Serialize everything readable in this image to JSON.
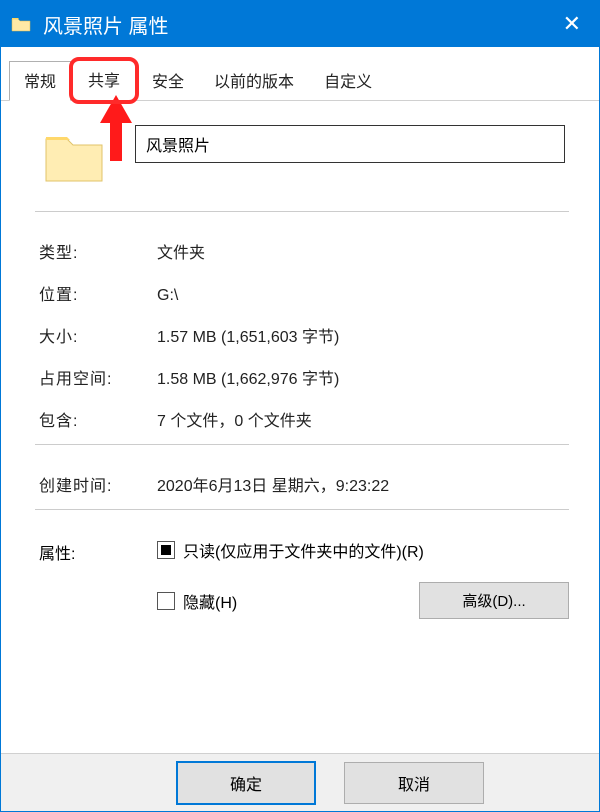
{
  "titlebar": {
    "title": "风景照片 属性"
  },
  "tabs": {
    "general": "常规",
    "sharing": "共享",
    "security": "安全",
    "previous": "以前的版本",
    "custom": "自定义"
  },
  "folder": {
    "name": "风景照片"
  },
  "labels": {
    "type": "类型:",
    "location": "位置:",
    "size": "大小:",
    "size_on_disk": "占用空间:",
    "contains": "包含:",
    "created": "创建时间:",
    "attributes": "属性:"
  },
  "values": {
    "type": "文件夹",
    "location": "G:\\",
    "size": "1.57 MB (1,651,603 字节)",
    "size_on_disk": "1.58 MB (1,662,976 字节)",
    "contains": "7 个文件，0 个文件夹",
    "created": "2020年6月13日 星期六，9:23:22"
  },
  "checkboxes": {
    "readonly": "只读(仅应用于文件夹中的文件)(R)",
    "hidden": "隐藏(H)"
  },
  "buttons": {
    "advanced": "高级(D)...",
    "ok": "确定",
    "cancel": "取消"
  }
}
